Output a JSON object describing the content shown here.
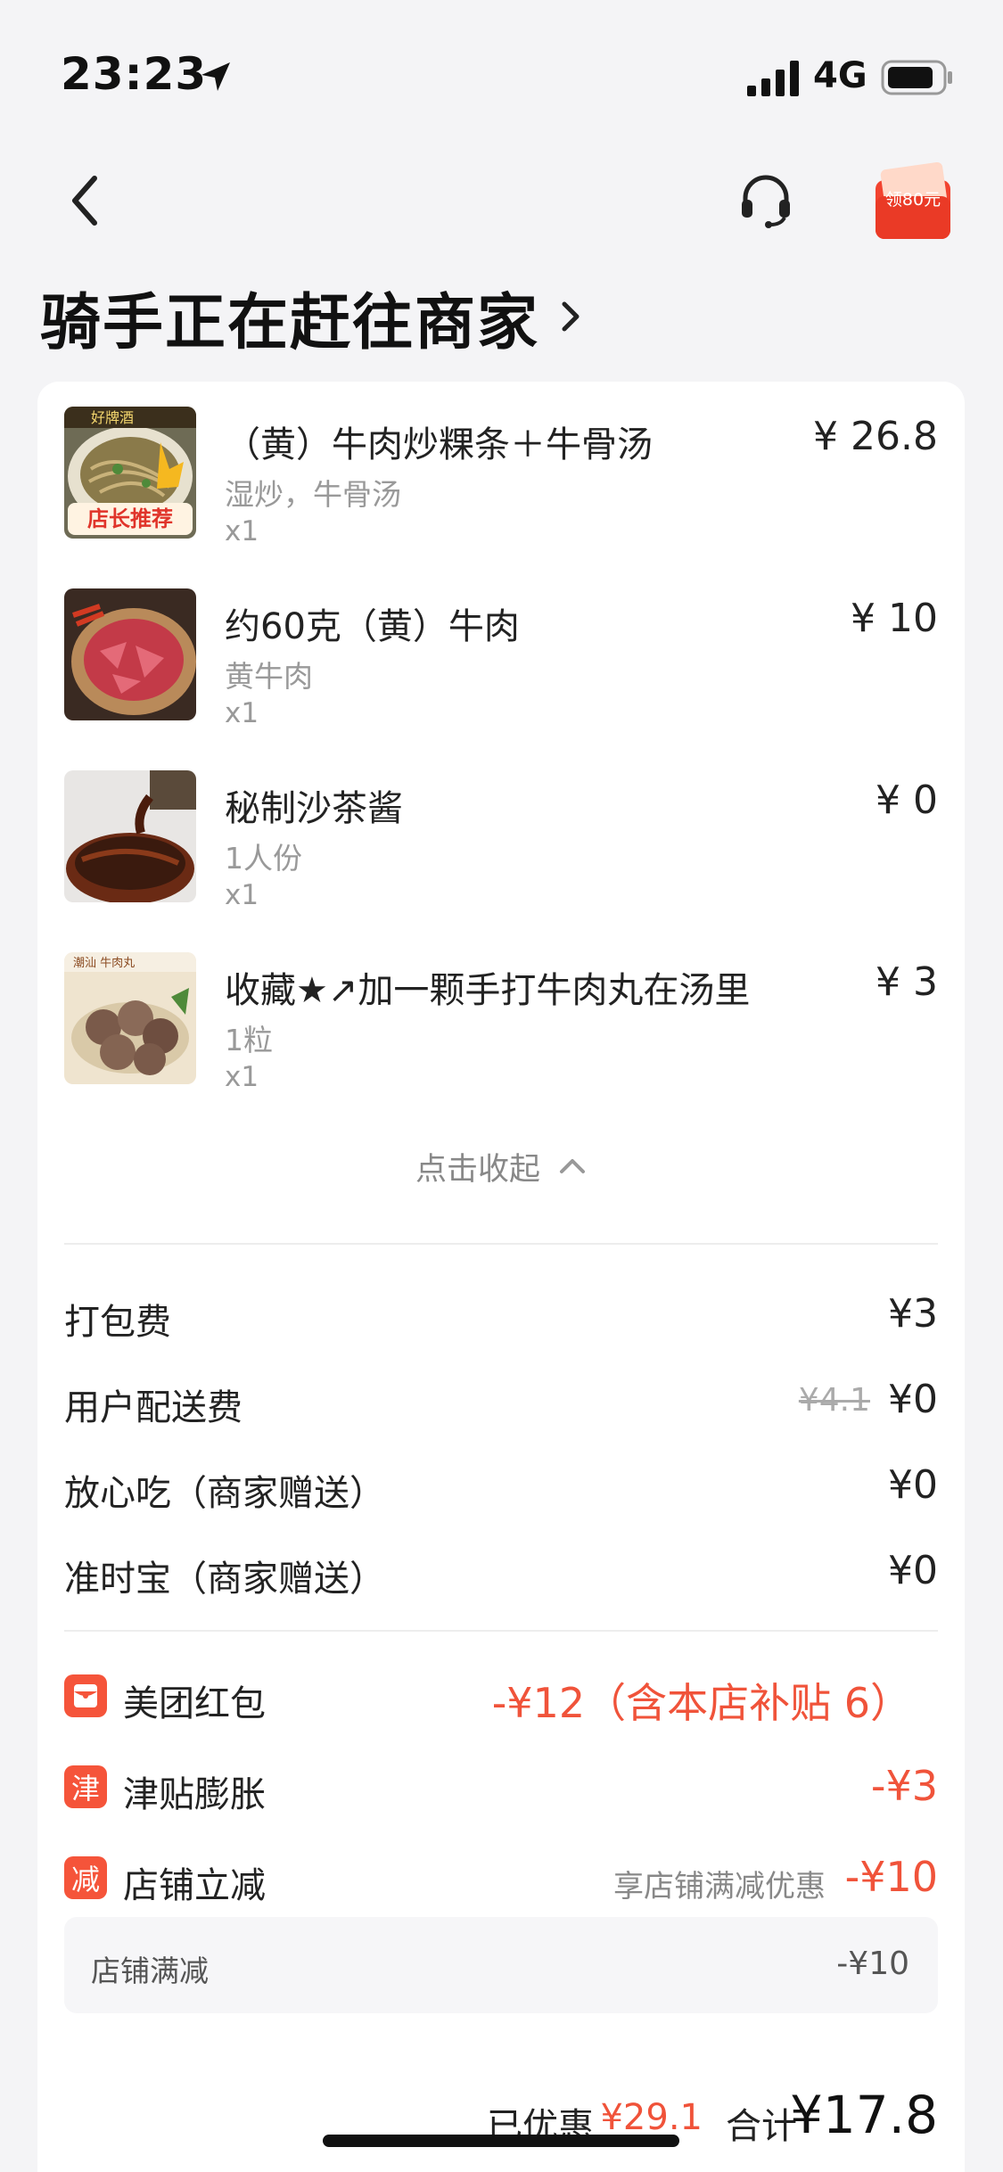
{
  "status_bar": {
    "time": "23:23",
    "network": "4G"
  },
  "nav": {
    "coupon_badge": "领80元"
  },
  "order_status": {
    "title": "骑手正在赶往商家"
  },
  "items": [
    {
      "name": "（黄）牛肉炒粿条＋牛骨汤",
      "spec": "湿炒，牛骨汤",
      "qty": "x1",
      "price": "¥ 26.8",
      "thumb_tag": "店长推荐",
      "thumb_top": "好牌酒"
    },
    {
      "name": "约60克（黄）牛肉",
      "spec": "黄牛肉",
      "qty": "x1",
      "price": "¥ 10"
    },
    {
      "name": "秘制沙茶酱",
      "spec": "1人份",
      "qty": "x1",
      "price": "¥ 0"
    },
    {
      "name": "收藏★↗加一颗手打牛肉丸在汤里",
      "spec": "1粒",
      "qty": "x1",
      "price": "¥ 3",
      "thumb_top": "潮汕 牛肉丸"
    }
  ],
  "collapse_label": "点击收起",
  "fees": [
    {
      "label": "打包费",
      "value": "¥3"
    },
    {
      "label": "用户配送费",
      "value": "¥0",
      "original": "¥4.1"
    },
    {
      "label": "放心吃（商家赠送）",
      "value": "¥0"
    },
    {
      "label": "准时宝（商家赠送）",
      "value": "¥0"
    }
  ],
  "discounts": [
    {
      "icon": "",
      "label": "美团红包",
      "value": "-¥12（含本店补贴 6）"
    },
    {
      "icon": "津",
      "label": "津贴膨胀",
      "value": "-¥3"
    },
    {
      "icon": "减",
      "label": "店铺立减",
      "value": "-¥10",
      "note": "享店铺满减优惠"
    }
  ],
  "sub_discount": {
    "label": "店铺满减",
    "value": "-¥10"
  },
  "totals": {
    "saved_label": "已优惠",
    "saved_value": "¥29.1",
    "total_label": "合计",
    "total_value": "¥17.8"
  },
  "colors": {
    "accent": "#f0533a",
    "background": "#f4f4f6"
  }
}
